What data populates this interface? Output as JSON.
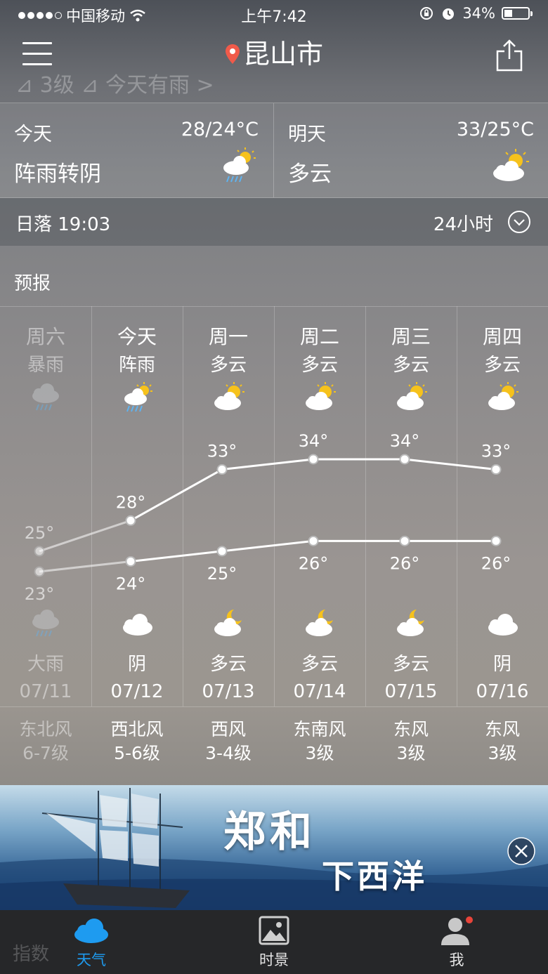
{
  "status_bar": {
    "carrier": "中国移动",
    "time": "上午7:42",
    "battery": "34%"
  },
  "header": {
    "city": "昆山市",
    "faded_text": "⊿ 3级 ⊿ 今天有雨 >"
  },
  "today": {
    "label": "今天",
    "temp": "28/24°C",
    "desc": "阵雨转阴"
  },
  "tomorrow": {
    "label": "明天",
    "temp": "33/25°C",
    "desc": "多云"
  },
  "sunset": {
    "text": "日落 19:03",
    "hours_label": "24小时"
  },
  "forecast": {
    "title": "预报",
    "days": [
      {
        "day": "周六",
        "weather": "暴雨",
        "high": "25°",
        "low": "23°",
        "night_weather": "大雨",
        "date": "07/11",
        "wind_dir": "东北风",
        "wind_level": "6-7级",
        "past": true,
        "day_icon": "rain-cloud-icon",
        "night_icon": "rain-cloud-icon"
      },
      {
        "day": "今天",
        "weather": "阵雨",
        "high": "28°",
        "low": "24°",
        "night_weather": "阴",
        "date": "07/12",
        "wind_dir": "西北风",
        "wind_level": "5-6级",
        "past": false,
        "day_icon": "sun-rain-icon",
        "night_icon": "cloud-icon"
      },
      {
        "day": "周一",
        "weather": "多云",
        "high": "33°",
        "low": "25°",
        "night_weather": "多云",
        "date": "07/13",
        "wind_dir": "西风",
        "wind_level": "3-4级",
        "past": false,
        "day_icon": "partly-cloudy-icon",
        "night_icon": "moon-cloud-icon"
      },
      {
        "day": "周二",
        "weather": "多云",
        "high": "34°",
        "low": "26°",
        "night_weather": "多云",
        "date": "07/14",
        "wind_dir": "东南风",
        "wind_level": "3级",
        "past": false,
        "day_icon": "partly-cloudy-icon",
        "night_icon": "moon-cloud-icon"
      },
      {
        "day": "周三",
        "weather": "多云",
        "high": "34°",
        "low": "26°",
        "night_weather": "多云",
        "date": "07/15",
        "wind_dir": "东风",
        "wind_level": "3级",
        "past": false,
        "day_icon": "partly-cloudy-icon",
        "night_icon": "moon-cloud-icon"
      },
      {
        "day": "周四",
        "weather": "多云",
        "high": "33°",
        "low": "26°",
        "night_weather": "阴",
        "date": "07/16",
        "wind_dir": "东风",
        "wind_level": "3级",
        "past": false,
        "day_icon": "partly-cloudy-icon",
        "night_icon": "cloud-icon"
      }
    ]
  },
  "chart_data": {
    "type": "line",
    "categories": [
      "07/11",
      "07/12",
      "07/13",
      "07/14",
      "07/15",
      "07/16"
    ],
    "series": [
      {
        "values": [
          25,
          28,
          33,
          34,
          34,
          33
        ]
      },
      {
        "values": [
          23,
          24,
          25,
          26,
          26,
          26
        ]
      }
    ]
  },
  "banner": {
    "line1": "郑和",
    "line2": "下西洋"
  },
  "tabbar": {
    "items": [
      {
        "label": "天气",
        "icon": "cloud-icon",
        "active": true
      },
      {
        "label": "时景",
        "icon": "photo-icon",
        "active": false
      },
      {
        "label": "我",
        "icon": "user-icon",
        "active": false
      }
    ],
    "faded_label": "指数"
  },
  "colors": {
    "accent": "#1e9bf0",
    "badge": "#e8443a",
    "sun": "#f6c21c",
    "rain": "#5fb3f0"
  }
}
